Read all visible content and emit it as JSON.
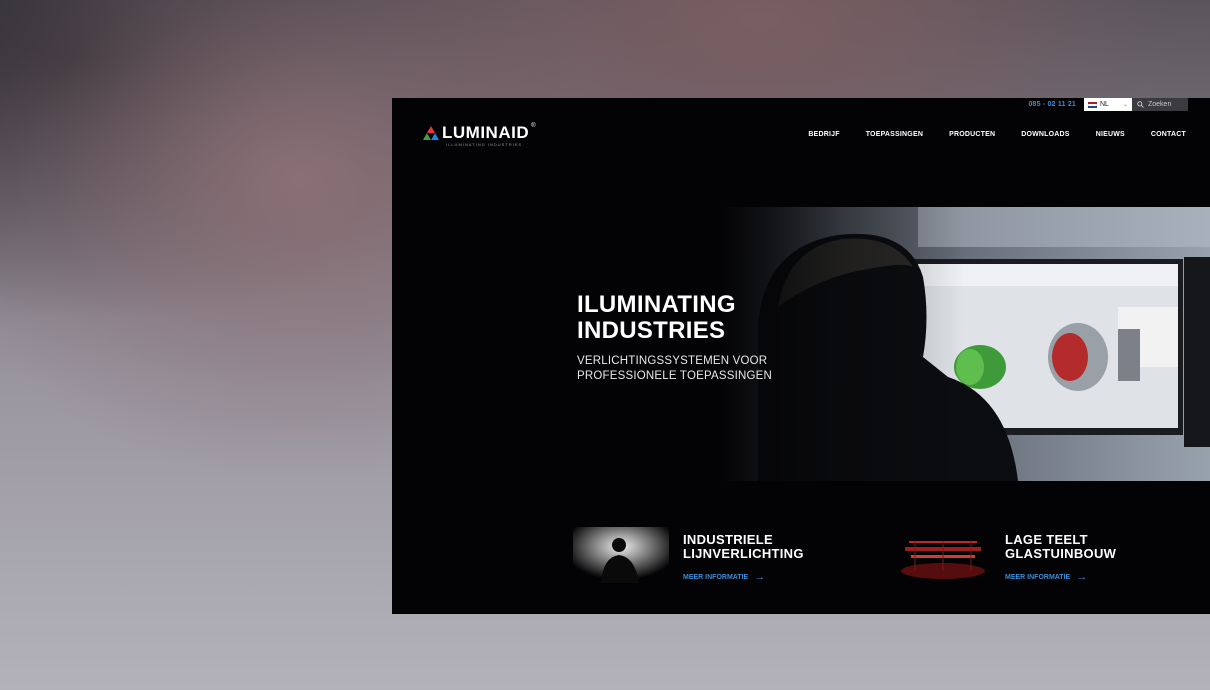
{
  "header": {
    "phone": "085 - 02 11 21",
    "language": "NL",
    "search_placeholder": "Zoeken"
  },
  "logo": {
    "name": "LUMINAID",
    "registered": "®",
    "tagline": "ILLUMINATING INDUSTRIES"
  },
  "nav": [
    "BEDRIJF",
    "TOEPASSINGEN",
    "PRODUCTEN",
    "DOWNLOADS",
    "NIEUWS",
    "CONTACT"
  ],
  "hero": {
    "title_line1": "ILUMINATING",
    "title_line2": "INDUSTRIES",
    "subtitle_line1": "VERLICHTINGSSYSTEMEN VOOR",
    "subtitle_line2": "PROFESSIONELE TOEPASSINGEN"
  },
  "cards": [
    {
      "title_line1": "INDUSTRIELE",
      "title_line2": "LIJNVERLICHTING",
      "link": "MEER INFORMATIE"
    },
    {
      "title_line1": "LAGE TEELT",
      "title_line2": "GLASTUINBOUW",
      "link": "MEER INFORMATIE"
    }
  ],
  "colors": {
    "accent": "#3b8bd4",
    "page": "#030305"
  }
}
